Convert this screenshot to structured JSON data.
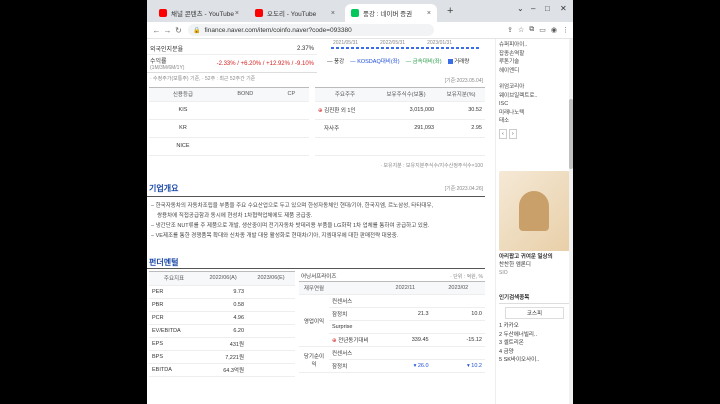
{
  "tabs": [
    {
      "label": "채널 콘텐츠 - YouTube Studio",
      "icon_color": "#ff0000"
    },
    {
      "label": "오도리 - YouTube",
      "icon_color": "#ff0000"
    },
    {
      "label": "풍강 : 네이버 증권",
      "icon_color": "#03c75a"
    }
  ],
  "url": "finance.naver.com/item/coinfo.naver?code=093380",
  "top_left": {
    "foreign_label": "외국인지분율",
    "foreign_value": "2.37%",
    "return_label": "수익률",
    "return_sub": "(1M/3M/6M/1Y)",
    "return_values": "-2.33% / +6.20% / +12.92% / -9.10%",
    "note": "· 수정주가(보통주) 기준, · 52주 : 최근 52주간 기준"
  },
  "chart_dates": [
    "2021/05/31",
    "2022/05/31",
    "2023/01/31"
  ],
  "chart_legend": [
    "풍강",
    "KOSDAQ대비(좌)",
    "금속대비(좌)",
    "거래량"
  ],
  "credit_header": [
    "신용등급",
    "BOND",
    "CP"
  ],
  "credit_rows": [
    "KIS",
    "KR",
    "NICE"
  ],
  "holder_date": "[기준:2023.05.04]",
  "holder_header": [
    "주요주주",
    "보유주식수(보통)",
    "보유지분(%)"
  ],
  "holder_rows": [
    {
      "name": "김진환 외 1인",
      "shares": "3,015,000",
      "pct": "30.52"
    },
    {
      "name": "자사주",
      "shares": "291,093",
      "pct": "2.95"
    }
  ],
  "holder_note": "· 보유지분 : 보유지분주식수/지수산정주식수×100",
  "overview": {
    "title": "기업개요",
    "date": "[기준:2023.04.26]",
    "lines": [
      "한국자동차의 자동차조립을 부품을 주요 수요산업으로 두고 있으며 한성자동체인 현대/기아, 한국지엠, 르노삼성, 타타대우,",
      "쌍용차에 직접공급함과 동시에 현성차 1차협력업체에도 제품 공급중.",
      "냉간단조 NUT류를 주 제품으로 개발, 생산중이며 전기자동차 밧데리용 부품을 LG화학 1차 업체를 통하여 공급하고 있음.",
      "VE제조를 통한 경쟁품목 확대와 신차종 개발 대응 활성화로 현대차/기아, 지엠대우에 대한 판매전략 대응중."
    ]
  },
  "fundamental": {
    "title": "펀더멘털",
    "header": [
      "주요지표",
      "2022/06(A)",
      "2023/06(E)"
    ],
    "rows": [
      {
        "k": "PER",
        "a": "9.73",
        "e": ""
      },
      {
        "k": "PBR",
        "a": "0.58",
        "e": ""
      },
      {
        "k": "PCR",
        "a": "4.96",
        "e": ""
      },
      {
        "k": "EV/EBITDA",
        "a": "6.20",
        "e": ""
      },
      {
        "k": "EPS",
        "a": "431원",
        "e": ""
      },
      {
        "k": "BPS",
        "a": "7,221원",
        "e": ""
      },
      {
        "k": "EBITDA",
        "a": "64.3억원",
        "e": ""
      }
    ]
  },
  "surprise": {
    "title": "어닝서프라이즈",
    "unit": "· 단위 : 억원, %",
    "header": [
      "재무연월",
      "",
      "2022/11",
      "2023/02"
    ],
    "group1": "영업이익",
    "group2": "당기순이익",
    "rows": [
      {
        "k": "컨센서스",
        "a": "",
        "b": ""
      },
      {
        "k": "잠정치",
        "a": "21.3",
        "b": "10.0"
      },
      {
        "k": "Surprise",
        "a": "",
        "b": ""
      },
      {
        "k": "전년동기대비",
        "a": "339.45",
        "b": "-15.12"
      },
      {
        "k": "컨센서스",
        "a": "",
        "b": ""
      },
      {
        "k": "잠정치",
        "a": "▾ 26.0",
        "b": "▾ 10.2"
      }
    ]
  },
  "sidebar": {
    "top_items": [
      "슈퍼피아이..",
      "잡종손역할",
      "루톤기술",
      "헤이엔디",
      "",
      "위엄코리아",
      "웨이브일렉트로..",
      "ISC",
      "미래나노텍",
      "태소"
    ],
    "ad_title": "아리팝고 귀여운 일상의",
    "ad_sub": "찬찬한 엠론디",
    "ad_brand": "SIO",
    "popular_title": "인기검색종목",
    "popular_tab": "코스피",
    "popular": [
      "1 카카오",
      "2 두산에너빌리..",
      "3 셀트리온",
      "4 금양",
      "5 SK바이오사이.."
    ]
  },
  "colors": {
    "accent_blue": "#1d4aa8",
    "up_red": "#d61f1f",
    "naver_green": "#03c75a"
  }
}
